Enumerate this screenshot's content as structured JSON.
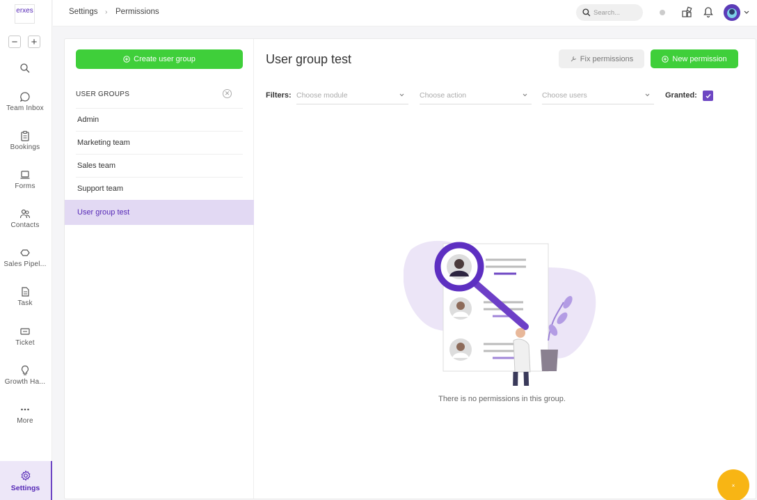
{
  "app": {
    "logo_text": "erxes"
  },
  "zoom": {
    "minus_label": "−",
    "plus_label": "+"
  },
  "sidebar": {
    "items": [
      {
        "label": "",
        "icon": "search-icon"
      },
      {
        "label": "Team Inbox",
        "icon": "chat-icon"
      },
      {
        "label": "Bookings",
        "icon": "clipboard-icon"
      },
      {
        "label": "Forms",
        "icon": "laptop-icon"
      },
      {
        "label": "Contacts",
        "icon": "users-icon"
      },
      {
        "label": "Sales Pipel...",
        "icon": "handshake-icon"
      },
      {
        "label": "Task",
        "icon": "file-icon"
      },
      {
        "label": "Ticket",
        "icon": "ticket-icon"
      },
      {
        "label": "Growth Ha...",
        "icon": "lightbulb-icon"
      },
      {
        "label": "More",
        "icon": "dots-icon"
      }
    ],
    "settings_label": "Settings"
  },
  "header": {
    "breadcrumb": [
      "Settings",
      "Permissions"
    ],
    "breadcrumb_sep": "›",
    "search_placeholder": "Search..."
  },
  "left_panel": {
    "create_button": "Create user group",
    "groups_heading": "USER GROUPS",
    "groups": [
      "Admin",
      "Marketing team",
      "Sales team",
      "Support team",
      "User group test"
    ],
    "active_group": "User group test"
  },
  "content": {
    "title": "User group test",
    "fix_button": "Fix permissions",
    "new_button": "New permission",
    "filters_label": "Filters:",
    "module_placeholder": "Choose module",
    "action_placeholder": "Choose action",
    "users_placeholder": "Choose users",
    "granted_label": "Granted:",
    "granted_checked": true,
    "empty_message": "There is no permissions in this group."
  },
  "fab": {
    "label": "×"
  },
  "colors": {
    "accent": "#5629b6",
    "green": "#3fcf3a",
    "active_bg": "#e2d9f3",
    "fab": "#f8b514"
  }
}
